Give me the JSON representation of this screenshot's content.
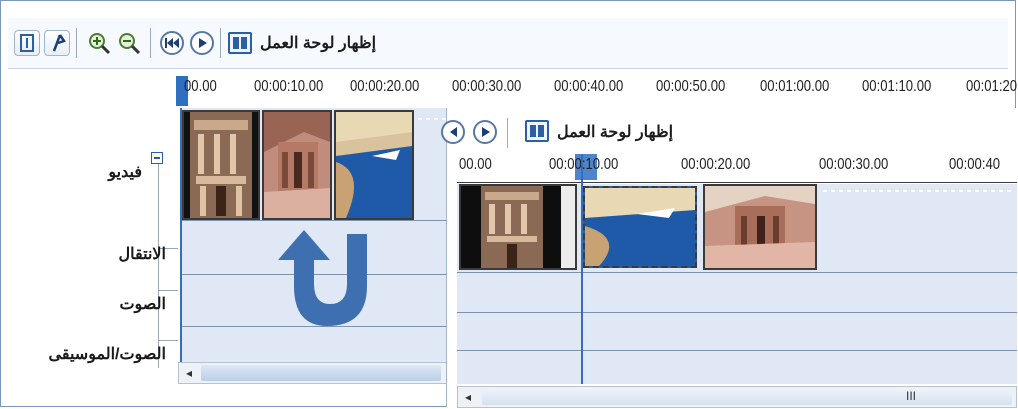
{
  "toolbar": {
    "storyboard_label": "إظهار لوحة العمل",
    "icons": [
      "storyboard-switch-icon",
      "narrate-icon",
      "zoom-in-icon",
      "zoom-out-icon",
      "rewind-icon",
      "play-icon",
      "storyboard-icon"
    ]
  },
  "ruler": {
    "ticks": [
      "00.00",
      "00:00:10.00",
      "00:00:20.00",
      "00:00:30.00",
      "00:00:40.00",
      "00:00:50.00",
      "00:01:00.00",
      "00:01:10.00",
      "00:01:20"
    ]
  },
  "tracks": {
    "video_label": "فيديو",
    "transition_label": "الانتقال",
    "audio_label": "الصوت",
    "music_label": "الصوت/الموسيقى"
  },
  "panel2": {
    "storyboard_label": "إظهار لوحة العمل",
    "ticks": [
      "00.00",
      "00:00:10.00",
      "00:00:20.00",
      "00:00:30.00",
      "00:00:40"
    ]
  },
  "scrollbar2": {
    "grip": "III"
  },
  "colors": {
    "accent": "#2f6fc0",
    "arrow": "#3e6fb0",
    "lane": "#dfe8f4"
  }
}
